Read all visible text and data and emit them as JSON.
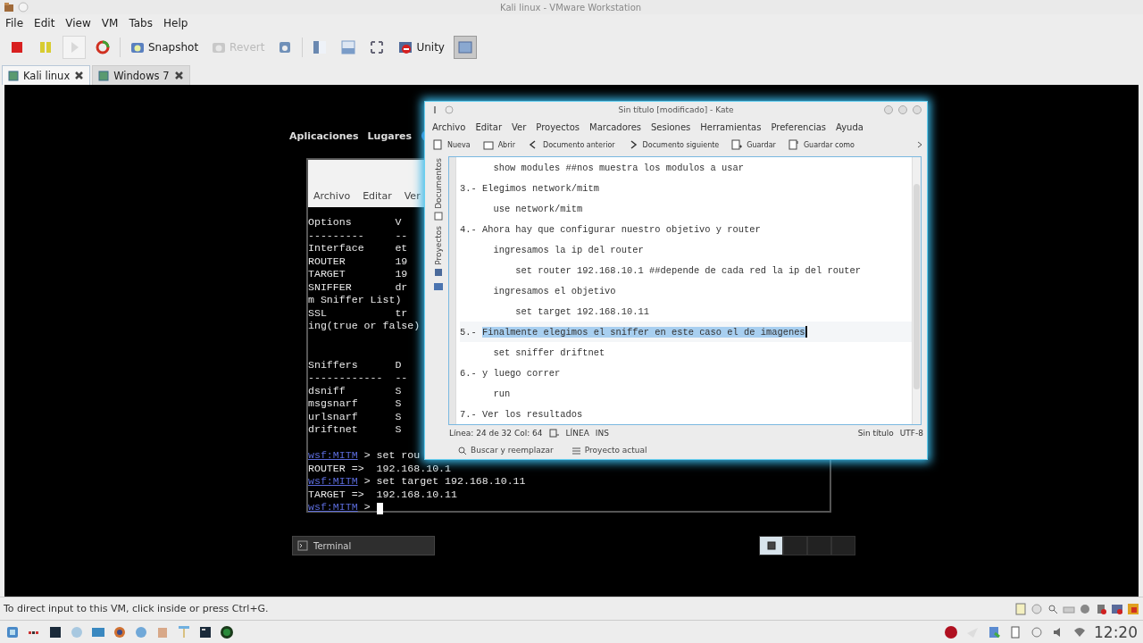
{
  "window": {
    "title": "Kali linux - VMware Workstation"
  },
  "menu": [
    "File",
    "Edit",
    "View",
    "VM",
    "Tabs",
    "Help"
  ],
  "toolbar": {
    "snapshot": {
      "label": "Snapshot"
    },
    "revert": {
      "label": "Revert",
      "disabled": true
    },
    "unity": {
      "label": "Unity"
    }
  },
  "vm_tabs": [
    {
      "label": "Kali linux",
      "selected": true
    },
    {
      "label": "Windows 7",
      "selected": false
    }
  ],
  "guest": {
    "top_panel": [
      "Aplicaciones",
      "Lugares"
    ],
    "terminal": {
      "menu": [
        "Archivo",
        "Editar",
        "Ver"
      ],
      "lines": [
        {
          "text": "Options       V"
        },
        {
          "text": "---------     --"
        },
        {
          "text": "Interface     et"
        },
        {
          "text": "ROUTER        19"
        },
        {
          "text": "TARGET        19"
        },
        {
          "text": "SNIFFER       dr"
        },
        {
          "text": "m Sniffer List)"
        },
        {
          "text": "SSL           tr"
        },
        {
          "text": "ing(true or false)",
          "gap_after": true
        },
        {
          "text": "Sniffers      D",
          "gap_before": true
        },
        {
          "text": "------------  --"
        },
        {
          "text": "dsniff        S"
        },
        {
          "text": "msgsnarf      S"
        },
        {
          "text": "urlsnarf      S"
        },
        {
          "text": "driftnet      S"
        },
        {
          "prompt": "wsf:MITM",
          "text": " > set rou",
          "gap_before": true
        },
        {
          "text": "ROUTER =>  192.168.10.1"
        },
        {
          "prompt": "wsf:MITM",
          "text": " > set target 192.168.10.11"
        },
        {
          "text": "TARGET =>  192.168.10.11"
        },
        {
          "prompt": "wsf:MITM",
          "text": " > ",
          "cursor": true
        }
      ]
    },
    "kate": {
      "title": "Sin título [modificado] - Kate",
      "menu": [
        "Archivo",
        "Editar",
        "Ver",
        "Proyectos",
        "Marcadores",
        "Sesiones",
        "Herramientas",
        "Preferencias",
        "Ayuda"
      ],
      "toolbar": [
        "Nueva",
        "Abrir",
        "Documento anterior",
        "Documento siguiente",
        "Guardar",
        "Guardar como"
      ],
      "side_tabs": [
        "Documentos",
        "Proyectos"
      ],
      "lines": [
        {
          "text": "      show modules ##nos muestra los modulos a usar"
        },
        {
          "text": "3.- Elegimos network/mitm"
        },
        {
          "text": "      use network/mitm"
        },
        {
          "text": "4.- Ahora hay que configurar nuestro objetivo y router"
        },
        {
          "text": "      ingresamos la ip del router"
        },
        {
          "text": "          set router 192.168.10.1 ##depende de cada red la ip del router"
        },
        {
          "text": "      ingresamos el objetivo"
        },
        {
          "text": "          set target 192.168.10.11"
        },
        {
          "text": "5.- ",
          "selection": "Finalmente elegimos el sniffer en este caso el de imagenes"
        },
        {
          "text": "      set sniffer driftnet"
        },
        {
          "text": "6.- y luego correr"
        },
        {
          "text": "      run"
        },
        {
          "text": "7.- Ver los resultados"
        }
      ],
      "status": {
        "position": "Línea: 24 de 32 Col: 64",
        "mode": "LÍNEA",
        "insert": "INS",
        "document": "Sin título",
        "encoding": "UTF-8"
      },
      "bottom_tools": [
        "Buscar y reemplazar",
        "Proyecto actual"
      ]
    },
    "bottom_panel": {
      "task": "Terminal",
      "workspaces": [
        {
          "selected": true
        },
        {
          "selected": false
        },
        {
          "selected": false
        },
        {
          "selected": false
        }
      ]
    }
  },
  "status_bar": {
    "message": "To direct input to this VM, click inside or press Ctrl+G."
  },
  "taskbar": {
    "clock": "12:20"
  }
}
